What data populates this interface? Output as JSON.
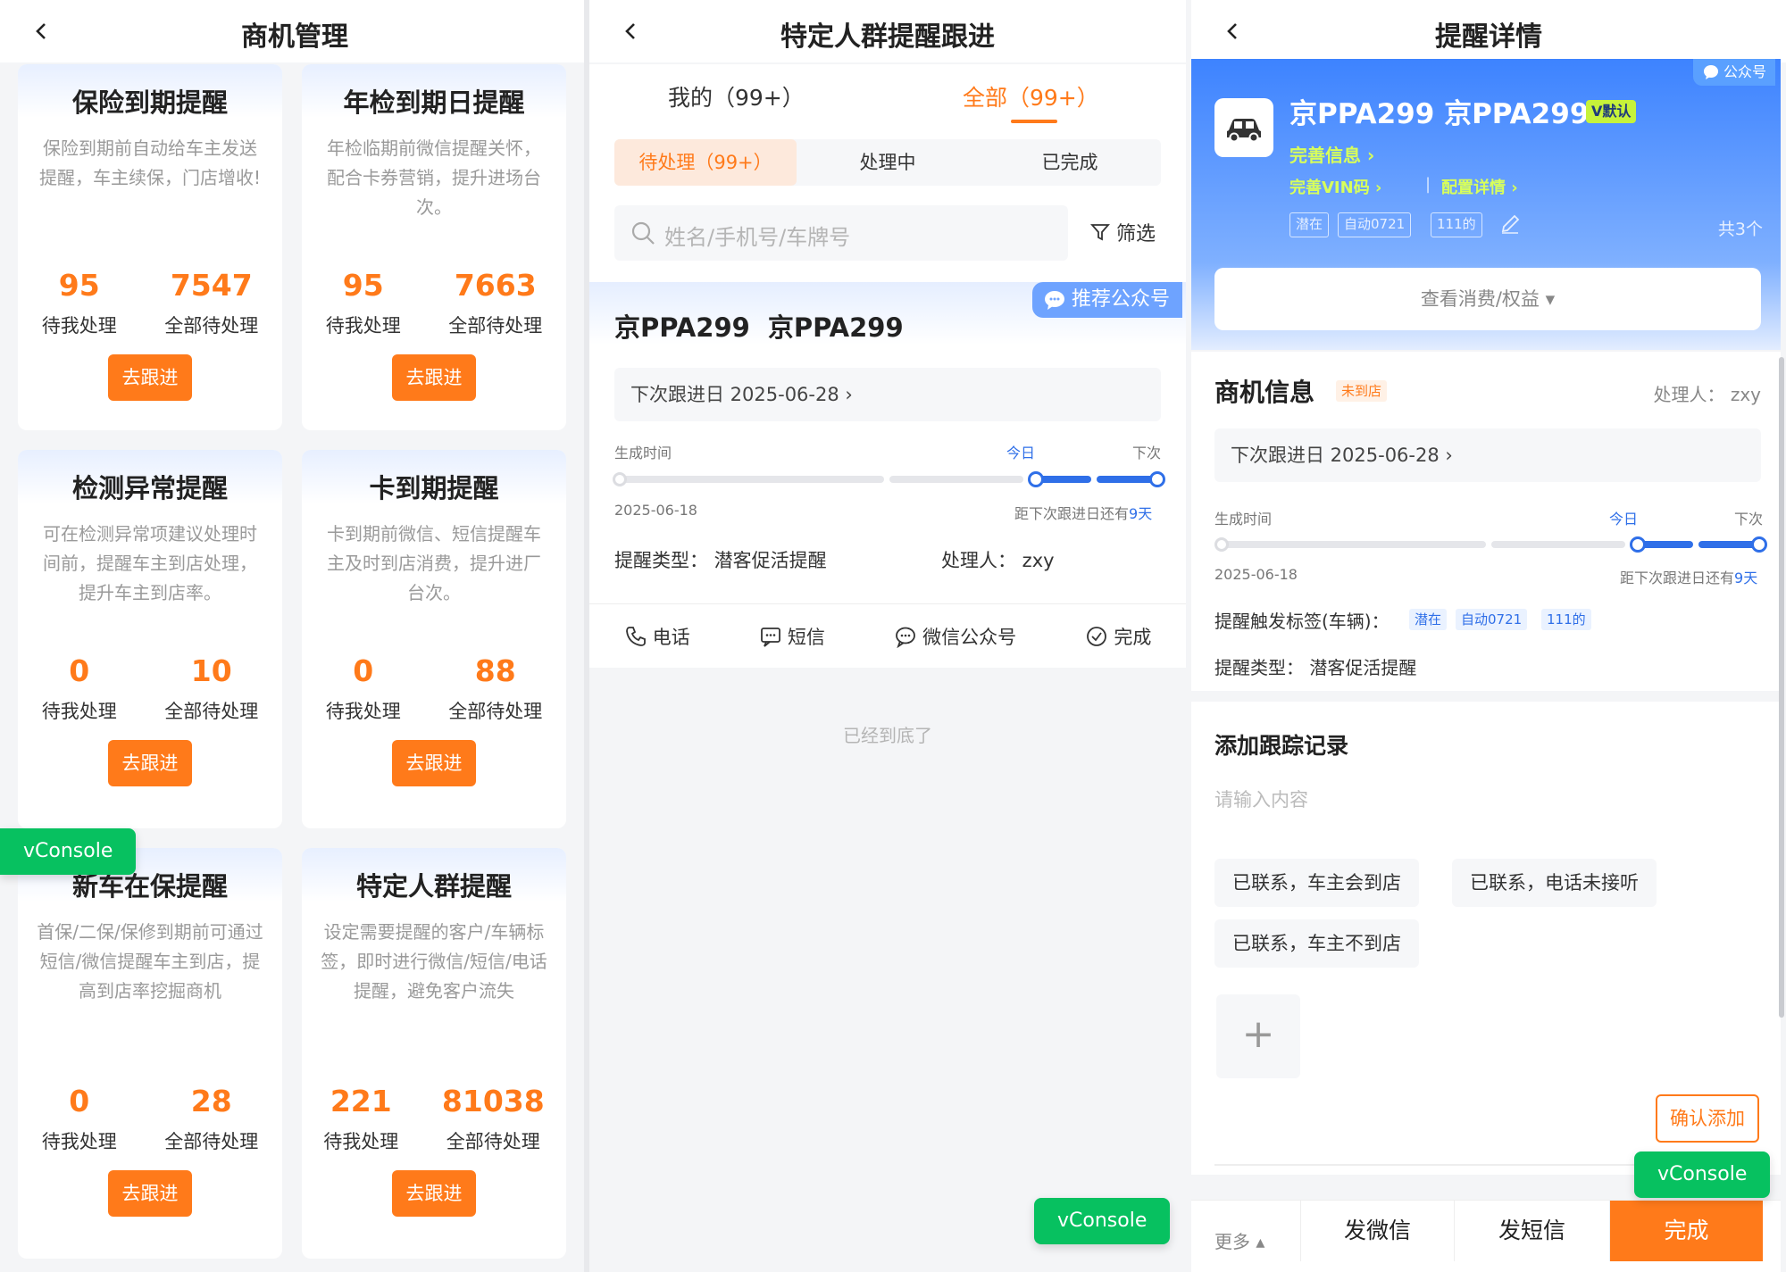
{
  "panel1": {
    "title": "商机管理",
    "cards": [
      {
        "title": "保险到期提醒",
        "desc": "保险到期前自动给车主发送提醒，车主续保，门店增收!",
        "mine": "95",
        "all": "7547"
      },
      {
        "title": "年检到期日提醒",
        "desc": "年检临期前微信提醒关怀，配合卡券营销，提升进场台次。",
        "mine": "95",
        "all": "7663"
      },
      {
        "title": "检测异常提醒",
        "desc": "可在检测异常项建议处理时间前，提醒车主到店处理，提升车主到店率。",
        "mine": "0",
        "all": "10"
      },
      {
        "title": "卡到期提醒",
        "desc": "卡到期前微信、短信提醒车主及时到店消费，提升进厂台次。",
        "mine": "0",
        "all": "88"
      },
      {
        "title": "新车在保提醒",
        "desc": "首保/二保/保修到期前可通过短信/微信提醒车主到店，提高到店率挖掘商机",
        "mine": "0",
        "all": "28"
      },
      {
        "title": "特定人群提醒",
        "desc": "设定需要提醒的客户/车辆标签，即时进行微信/短信/电话提醒，避免客户流失",
        "mine": "221",
        "all": "81038"
      }
    ],
    "mine_label": "待我处理",
    "all_label": "全部待处理",
    "go_label": "去跟进"
  },
  "vconsole_label": "vConsole",
  "panel2": {
    "title": "特定人群提醒跟进",
    "tab_mine": "我的（99+）",
    "tab_all": "全部（99+）",
    "subtabs": [
      "待处理（99+）",
      "处理中",
      "已完成"
    ],
    "search_placeholder": "姓名/手机号/车牌号",
    "filter_label": "筛选",
    "recommend_label": "推荐公众号",
    "plate_a": "京PPA299",
    "plate_b": "京PPA299",
    "next_followup": "下次跟进日 2025-06-28",
    "gen_time_label": "生成时间",
    "today_label": "今日",
    "next_label": "下次",
    "gen_date": "2025-06-18",
    "remaining_prefix": "距下次跟进日还有",
    "remaining_days": "9天",
    "reminder_type": "提醒类型：  潜客促活提醒",
    "handler": "处理人：  zxy",
    "actions": [
      "电话",
      "短信",
      "微信公众号",
      "完成"
    ],
    "bottom_note": "已经到底了"
  },
  "panel3": {
    "title": "提醒详情",
    "wx_badge": "公众号",
    "plate": "京PPA299 京PPA299",
    "v_default": "V默认",
    "complete_info": "完善信息 ›",
    "complete_vin": "完善VIN码 ›",
    "config_detail": "配置详情 ›",
    "tags": [
      "潜在",
      "自动0721",
      "111的"
    ],
    "total": "共3个",
    "view_consume": "查看消费/权益 ▾",
    "biz_title": "商机信息",
    "not_arrived": "未到店",
    "handler": "处理人：  zxy",
    "next_followup": "下次跟进日 2025-06-28",
    "gen_time_label": "生成时间",
    "today_label": "今日",
    "next_label": "下次",
    "gen_date": "2025-06-18",
    "remaining_prefix": "距下次跟进日还有",
    "remaining_days": "9天",
    "trigger_label": "提醒触发标签(车辆)：",
    "reminder_type": "提醒类型：  潜客促活提醒",
    "add_title": "添加跟踪记录",
    "input_placeholder": "请输入内容",
    "chips": [
      "已联系，车主会到店",
      "已联系，电话未接听",
      "已联系，车主不到店"
    ],
    "plus": "+",
    "confirm_add": "确认添加",
    "more": "更多 ▴",
    "footer_buttons": [
      "发微信",
      "发短信",
      "完成"
    ]
  },
  "colors": {
    "accent": "#ff7a1a",
    "blue": "#2f6fe8",
    "green": "#07c160"
  }
}
